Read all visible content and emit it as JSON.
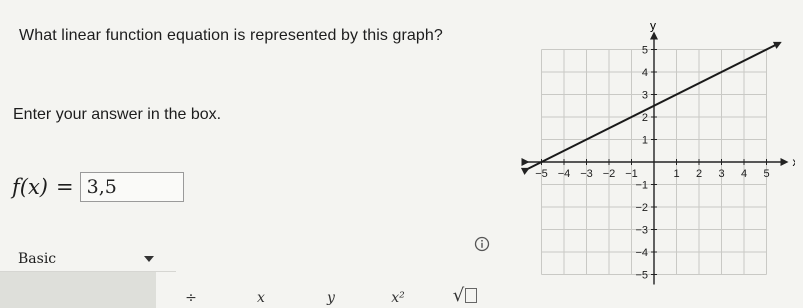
{
  "question": "What linear function equation is represented by this graph?",
  "instruction": "Enter your answer in the box.",
  "answer": {
    "lhs": "f(x)",
    "equals": "=",
    "value": "3,5"
  },
  "mode_select": {
    "selected": "Basic"
  },
  "toolbar": {
    "buttons": [
      {
        "label": ""
      },
      {
        "label": ""
      },
      {
        "label": "÷"
      },
      {
        "label": "x"
      },
      {
        "label": "y"
      },
      {
        "label": "x²"
      },
      {
        "label": "√"
      }
    ]
  },
  "chart_data": {
    "type": "line",
    "xlabel": "x",
    "ylabel": "y",
    "xlim": [
      -5,
      5
    ],
    "ylim": [
      -5,
      5
    ],
    "x_ticks": [
      "-5",
      "-4",
      "-3",
      "-2",
      "-1",
      "1",
      "2",
      "3",
      "4",
      "5"
    ],
    "y_ticks": [
      "5",
      "4",
      "3",
      "2",
      "1",
      "-1",
      "-2",
      "-3",
      "-4",
      "-5"
    ],
    "grid": true,
    "series": [
      {
        "x": [
          -5,
          5
        ],
        "y": [
          0,
          5
        ]
      }
    ],
    "colors": {
      "line": "#1a1a1a",
      "grid": "#c9c9c5",
      "axes": "#222222"
    }
  }
}
